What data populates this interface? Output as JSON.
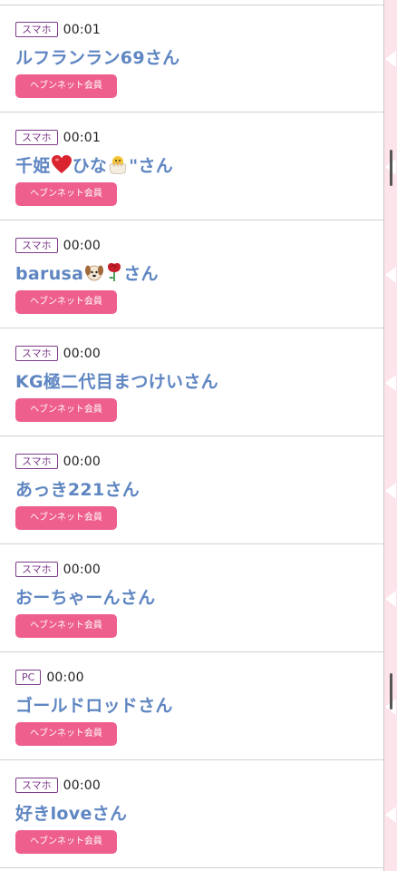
{
  "members": [
    {
      "device": "スマホ",
      "time": "00:01",
      "name": "ルフランラン69さん",
      "badge": "ヘブンネット会員"
    },
    {
      "device": "スマホ",
      "time": "00:01",
      "name_part1": "千姫",
      "name_part2": "ひな",
      "name_part3": "\"さん",
      "badge": "ヘブンネット会員"
    },
    {
      "device": "スマホ",
      "time": "00:00",
      "name_part1": "barusa",
      "name_part2": "さん",
      "badge": "ヘブンネット会員"
    },
    {
      "device": "スマホ",
      "time": "00:00",
      "name": "KG極二代目まつけいさん",
      "badge": "ヘブンネット会員"
    },
    {
      "device": "スマホ",
      "time": "00:00",
      "name": "あっき221さん",
      "badge": "ヘブンネット会員"
    },
    {
      "device": "スマホ",
      "time": "00:00",
      "name": "おーちゃーんさん",
      "badge": "ヘブンネット会員"
    },
    {
      "device": "PC",
      "time": "00:00",
      "name": "ゴールドロッドさん",
      "badge": "ヘブンネット会員"
    },
    {
      "device": "スマホ",
      "time": "00:00",
      "name": "好きloveさん",
      "badge": "ヘブンネット会員"
    }
  ],
  "colors": {
    "name_link": "#5f86c2",
    "badge_bg": "#ee5f8d",
    "device_border": "#7d3b8a",
    "rail_bg": "#fde3ea"
  },
  "icons": {
    "row2": [
      "red-heart-emoji-icon",
      "hatching-chick-emoji-icon"
    ],
    "row3": [
      "dog-face-emoji-icon",
      "rose-emoji-icon"
    ],
    "rail": "chevron-left-icon"
  }
}
